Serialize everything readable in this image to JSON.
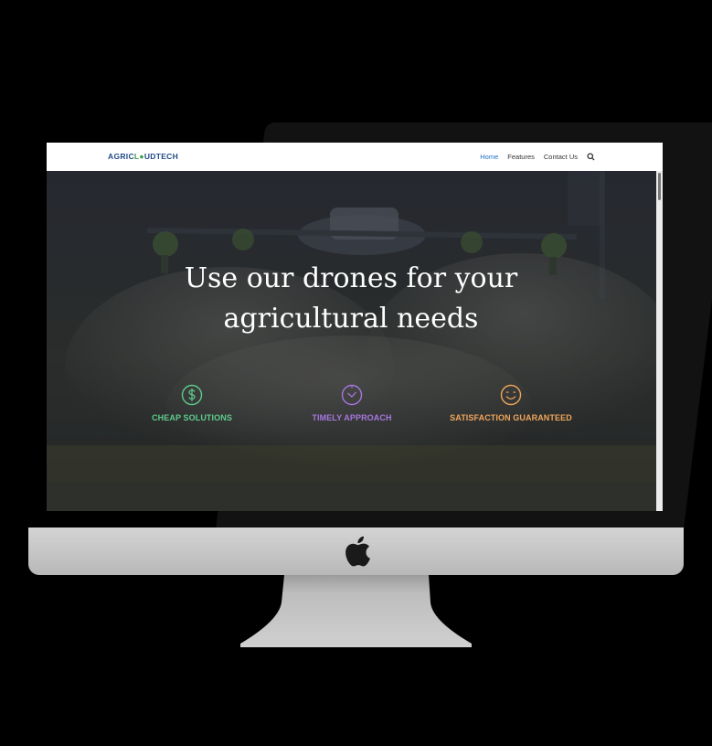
{
  "logo": {
    "part1": "AGRIC",
    "part2": "L",
    "part3": "UDTECH"
  },
  "nav": {
    "items": [
      "Home",
      "Features",
      "Contact Us"
    ],
    "active": "Home"
  },
  "hero": {
    "title_line1": "Use our drones for your",
    "title_line2": "agricultural needs"
  },
  "features": [
    {
      "label": "CHEAP SOLUTIONS",
      "icon": "dollar-icon",
      "color": "#5fcb8d"
    },
    {
      "label": "TIMELY APPROACH",
      "icon": "clock-icon",
      "color": "#a776e0"
    },
    {
      "label": "SATISFACTION GUARANTEED",
      "icon": "smile-icon",
      "color": "#f0a55a"
    }
  ],
  "colors": {
    "nav_active": "#1f6fc4",
    "logo_blue": "#214a86",
    "logo_green": "#3a9a48",
    "monitor_chin": "#c8c8c8"
  }
}
